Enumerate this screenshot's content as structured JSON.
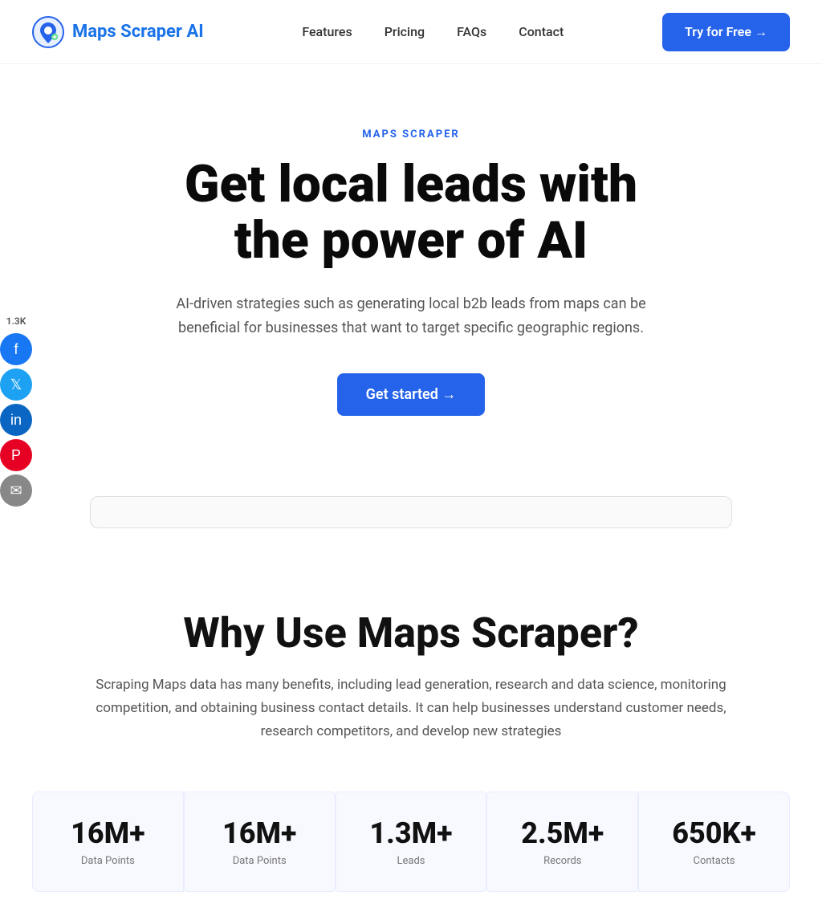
{
  "nav": {
    "logo_text": "Maps Scraper AI",
    "links": [
      {
        "label": "Features",
        "href": "#"
      },
      {
        "label": "Pricing",
        "href": "#"
      },
      {
        "label": "FAQs",
        "href": "#"
      },
      {
        "label": "Contact",
        "href": "#"
      }
    ],
    "cta_label": "Try for Free →"
  },
  "social": {
    "count": "1.3K"
  },
  "hero": {
    "tag": "MAPS SCRAPER",
    "title_line1": "Get local leads with",
    "title_line2": "the power of AI",
    "subtitle": "AI-driven strategies such as generating local b2b leads from maps can be beneficial for businesses that want to target specific geographic regions.",
    "cta_label": "Get started →"
  },
  "why": {
    "title": "Why Use Maps Scraper?",
    "description": "Scraping Maps data has many benefits, including lead generation, research and data science, monitoring competition, and obtaining business contact details. It can help businesses understand customer needs, research competitors, and develop new strategies"
  },
  "stats": [
    {
      "value": "16M+",
      "label": "Data Points"
    },
    {
      "value": "16M+",
      "label": "Data Points"
    },
    {
      "value": "1.3M+",
      "label": "Leads"
    },
    {
      "value": "2.5M+",
      "label": "Records"
    },
    {
      "value": "650K+",
      "label": "Contacts"
    }
  ]
}
